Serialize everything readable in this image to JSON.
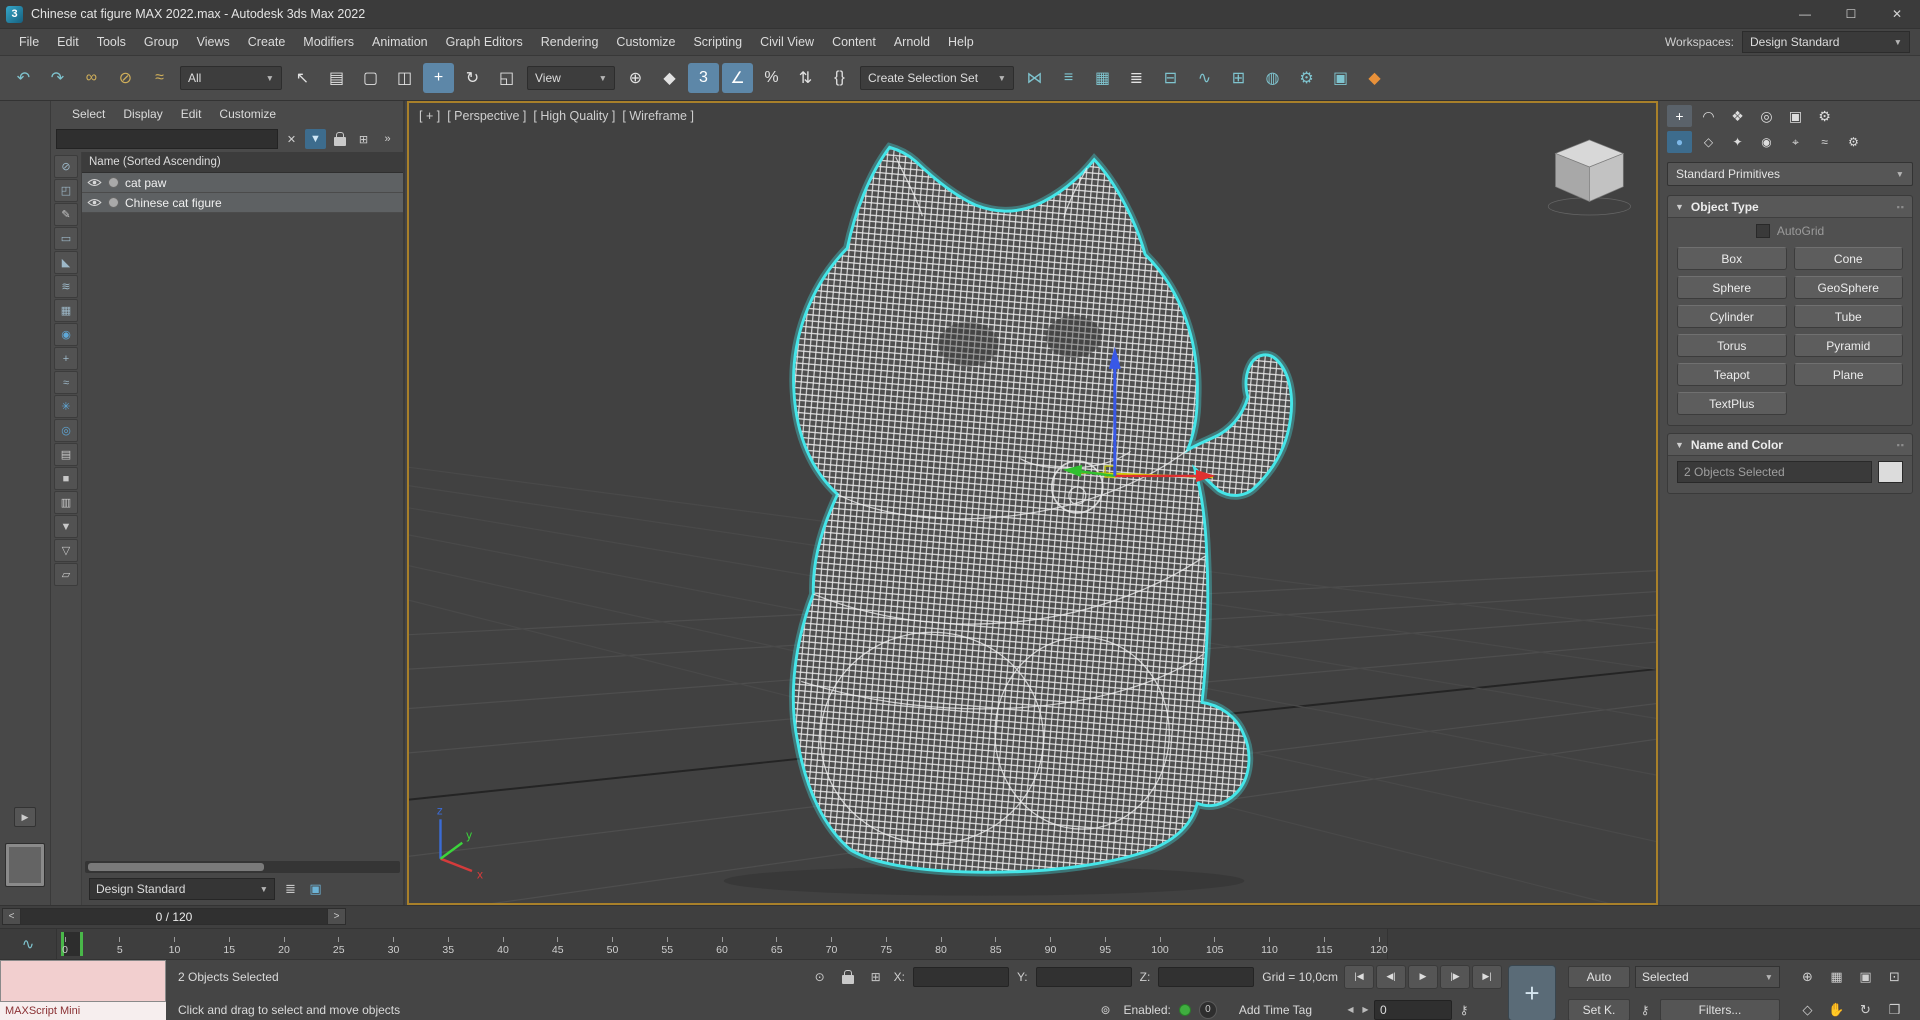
{
  "titlebar": {
    "app_icon_label": "3",
    "title": "Chinese cat figure MAX 2022.max - Autodesk 3ds Max 2022",
    "minimize_glyph": "—",
    "maximize_glyph": "☐",
    "close_glyph": "✕"
  },
  "menubar": {
    "items": [
      "File",
      "Edit",
      "Tools",
      "Group",
      "Views",
      "Create",
      "Modifiers",
      "Animation",
      "Graph Editors",
      "Rendering",
      "Customize",
      "Scripting",
      "Civil View",
      "Content",
      "Arnold",
      "Help"
    ],
    "workspaces_label": "Workspaces:",
    "workspaces_value": "Design Standard"
  },
  "toolbar": {
    "icons_a": [
      {
        "name": "undo-icon",
        "glyph": "↶",
        "color": "#7fc4cf"
      },
      {
        "name": "redo-icon",
        "glyph": "↷",
        "color": "#7fc4cf"
      },
      {
        "name": "select-and-link-icon",
        "glyph": "∞",
        "color": "#cfae5a"
      },
      {
        "name": "unlink-selection-icon",
        "glyph": "⊘",
        "color": "#cfae5a"
      },
      {
        "name": "bind-to-space-warp-icon",
        "glyph": "≈",
        "color": "#cfae5a"
      }
    ],
    "filter_value": "All",
    "icons_b": [
      {
        "name": "select-object-icon",
        "glyph": "↖",
        "color": "#e2e2e2"
      },
      {
        "name": "select-by-name-icon",
        "glyph": "▤",
        "color": "#e2e2e2"
      },
      {
        "name": "rectangular-selection-region-icon",
        "glyph": "▢",
        "color": "#e2e2e2"
      },
      {
        "name": "window-crossing-toggle-icon",
        "glyph": "◫",
        "color": "#e2e2e2"
      },
      {
        "name": "select-and-move-icon",
        "glyph": "+",
        "color": "#ffffff",
        "active": true
      },
      {
        "name": "select-and-rotate-icon",
        "glyph": "↻",
        "color": "#e2e2e2"
      },
      {
        "name": "select-and-scale-icon",
        "glyph": "◱",
        "color": "#e2e2e2"
      }
    ],
    "coord_value": "View",
    "icons_c": [
      {
        "name": "use-pivot-center-icon",
        "glyph": "⊕",
        "color": "#e2e2e2"
      },
      {
        "name": "select-and-manipulate-icon",
        "glyph": "◆",
        "color": "#e2e2e2"
      },
      {
        "name": "snap-toggle-3d-icon",
        "glyph": "3",
        "color": "#ffffff",
        "active": true
      },
      {
        "name": "angle-snap-icon",
        "glyph": "∠",
        "color": "#ffffff",
        "active": true
      },
      {
        "name": "percent-snap-icon",
        "glyph": "%",
        "color": "#e2e2e2"
      },
      {
        "name": "spinner-snap-icon",
        "glyph": "⇅",
        "color": "#e2e2e2"
      },
      {
        "name": "edit-named-selection-sets-icon",
        "glyph": "{}",
        "color": "#e2e2e2"
      }
    ],
    "selection_set_value": "Create Selection Set",
    "icons_d": [
      {
        "name": "mirror-icon",
        "glyph": "⋈",
        "color": "#7fc4cf"
      },
      {
        "name": "align-icon",
        "glyph": "≡",
        "color": "#7fc4cf"
      },
      {
        "name": "toggle-scene-explorer-icon",
        "glyph": "▦",
        "color": "#7fc4cf"
      },
      {
        "name": "toggle-layer-explorer-icon",
        "glyph": "≣",
        "color": "#e2e2e2"
      },
      {
        "name": "toggle-ribbon-icon",
        "glyph": "⊟",
        "color": "#7fc4cf"
      },
      {
        "name": "curve-editor-icon",
        "glyph": "∿",
        "color": "#7fc4cf"
      },
      {
        "name": "schematic-view-icon",
        "glyph": "⊞",
        "color": "#7fc4cf"
      },
      {
        "name": "material-editor-icon",
        "glyph": "◍",
        "color": "#7fc4cf"
      },
      {
        "name": "render-setup-icon",
        "glyph": "⚙",
        "color": "#7fc4cf"
      },
      {
        "name": "rendered-frame-window-icon",
        "glyph": "▣",
        "color": "#7fc4cf"
      },
      {
        "name": "render-production-icon",
        "glyph": "◆",
        "color": "#e8913a"
      }
    ]
  },
  "explorer": {
    "menu": [
      "Select",
      "Display",
      "Edit",
      "Customize"
    ],
    "search_value": "",
    "clear_glyph": "✕",
    "filter_glyph": "▼",
    "pick_glyph": "⊞",
    "overflow_glyph": "»",
    "header": "Name (Sorted Ascending)",
    "rows": [
      {
        "label": "cat paw"
      },
      {
        "label": "Chinese cat figure"
      }
    ],
    "side_icons": [
      {
        "name": "display-none-icon",
        "glyph": "⊘",
        "color": "#9db8c8"
      },
      {
        "name": "display-children-icon",
        "glyph": "◰",
        "color": "#9db8c8"
      },
      {
        "name": "lock-cell-editing-icon",
        "glyph": "✎",
        "color": "#c8c8c8"
      },
      {
        "name": "display-geometry-icon",
        "glyph": "▭",
        "color": "#9db8c8"
      },
      {
        "name": "display-shapes-icon",
        "glyph": "◣",
        "color": "#9db8c8"
      },
      {
        "name": "display-lights-icon",
        "glyph": "≋",
        "color": "#9db8c8"
      },
      {
        "name": "display-cameras-icon",
        "glyph": "▦",
        "color": "#9db8c8"
      },
      {
        "name": "display-materials-icon",
        "glyph": "◉",
        "color": "#5fa8d8"
      },
      {
        "name": "display-helpers-icon",
        "glyph": "+",
        "color": "#9db8c8"
      },
      {
        "name": "display-space-warps-icon",
        "glyph": "≈",
        "color": "#9db8c8"
      },
      {
        "name": "display-particles-icon",
        "glyph": "✳",
        "color": "#5fa8d8"
      },
      {
        "name": "display-visibility-icon",
        "glyph": "◎",
        "color": "#5fa8d8"
      },
      {
        "name": "display-frozen-icon",
        "glyph": "▤",
        "color": "#c8c8c8"
      },
      {
        "name": "display-hidden-icon",
        "glyph": "■",
        "color": "#c8c8c8"
      },
      {
        "name": "display-notes-icon",
        "glyph": "▥",
        "color": "#c8c8c8"
      },
      {
        "name": "filter-combinations-icon",
        "glyph": "▼",
        "color": "#c8c8c8"
      },
      {
        "name": "advanced-filter-icon",
        "glyph": "▽",
        "color": "#c8c8c8"
      },
      {
        "name": "folder-display-icon",
        "glyph": "▱",
        "color": "#c8c8c8"
      }
    ],
    "workspace_dropdown_value": "Design Standard",
    "bottom_icons": [
      {
        "name": "layer-explorer-icon",
        "glyph": "≣",
        "color": "#c8c8c8"
      },
      {
        "name": "scene-explorer-display-icon",
        "glyph": "▣",
        "color": "#6db3d6"
      }
    ]
  },
  "viewport": {
    "labels": [
      {
        "name": "viewport-general-menu",
        "label": "[ + ]"
      },
      {
        "name": "viewport-pov-menu",
        "label": "[ Perspective ]"
      },
      {
        "name": "viewport-quality-menu",
        "label": "[ High Quality ]"
      },
      {
        "name": "viewport-shading-menu",
        "label": "[ Wireframe ]"
      }
    ],
    "axis_x_label": "x",
    "axis_y_label": "y",
    "axis_z_label": "z",
    "selection_outline_color": "#45e6e9"
  },
  "command_panel": {
    "tabs": [
      {
        "name": "create-tab-icon",
        "glyph": "+",
        "active": true
      },
      {
        "name": "modify-tab-icon",
        "glyph": "◠"
      },
      {
        "name": "hierarchy-tab-icon",
        "glyph": "❖"
      },
      {
        "name": "motion-tab-icon",
        "glyph": "◎"
      },
      {
        "name": "display-tab-icon",
        "glyph": "▣"
      },
      {
        "name": "utilities-tab-icon",
        "glyph": "⚙"
      }
    ],
    "subtabs": [
      {
        "name": "geometry-category-icon",
        "glyph": "●",
        "color": "#7db8e8",
        "active": true
      },
      {
        "name": "shapes-category-icon",
        "glyph": "◇"
      },
      {
        "name": "lights-category-icon",
        "glyph": "✦"
      },
      {
        "name": "cameras-category-icon",
        "glyph": "◉"
      },
      {
        "name": "helpers-category-icon",
        "glyph": "⌖"
      },
      {
        "name": "space-warps-category-icon",
        "glyph": "≈"
      },
      {
        "name": "systems-category-icon",
        "glyph": "⚙"
      }
    ],
    "category_dropdown_value": "Standard Primitives",
    "object_type_title": "Object Type",
    "autogrid_label": "AutoGrid",
    "primitive_buttons": [
      {
        "name": "box-button",
        "label": "Box"
      },
      {
        "name": "cone-button",
        "label": "Cone"
      },
      {
        "name": "sphere-button",
        "label": "Sphere"
      },
      {
        "name": "geosphere-button",
        "label": "GeoSphere"
      },
      {
        "name": "cylinder-button",
        "label": "Cylinder"
      },
      {
        "name": "tube-button",
        "label": "Tube"
      },
      {
        "name": "torus-button",
        "label": "Torus"
      },
      {
        "name": "pyramid-button",
        "label": "Pyramid"
      },
      {
        "name": "teapot-button",
        "label": "Teapot"
      },
      {
        "name": "plane-button",
        "label": "Plane"
      },
      {
        "name": "textplus-button",
        "label": "TextPlus"
      }
    ],
    "name_color_title": "Name and Color",
    "name_field_value": "2 Objects Selected"
  },
  "timeline": {
    "slider_value": "0 / 120",
    "prev_glyph": "<",
    "next_glyph": ">",
    "mini_curve_glyph": "∿",
    "ticks": [
      "0",
      "5",
      "10",
      "15",
      "20",
      "25",
      "30",
      "35",
      "40",
      "45",
      "50",
      "55",
      "60",
      "65",
      "70",
      "75",
      "80",
      "85",
      "90",
      "95",
      "100",
      "105",
      "110",
      "115",
      "120"
    ]
  },
  "statusbar": {
    "maxscript_label": "MAXScript Mini",
    "selection_status": "2 Objects Selected",
    "prompt": "Click and drag to select and move objects",
    "isolate_glyph": "⊙",
    "absolute_glyph": "⊞",
    "x_label": "X:",
    "y_label": "Y:",
    "z_label": "Z:",
    "x_value": "",
    "y_value": "",
    "z_value": "",
    "grid_label": "Grid = 10,0cm",
    "playback_glyph": "⊚",
    "enabled_label": "Enabled:",
    "enabled_value": "0",
    "add_time_tag_label": "Add Time Tag",
    "transport": [
      {
        "name": "go-to-start-button",
        "glyph": "|◀"
      },
      {
        "name": "previous-frame-button",
        "glyph": "◀|"
      },
      {
        "name": "play-button",
        "glyph": "▶"
      },
      {
        "name": "next-frame-button",
        "glyph": "|▶"
      },
      {
        "name": "go-to-end-button",
        "glyph": "▶|"
      }
    ],
    "key_step_prev_glyph": "◀",
    "key_step_next_glyph": "▶",
    "frame_value": "0",
    "set_keys_glyph": "+",
    "auto_key_label": "Auto",
    "key_set_dropdown_value": "Selected",
    "set_key_label": "Set K.",
    "key_filters_glyph": "⚷",
    "filters_label": "Filters...",
    "nav_icons_top": [
      {
        "name": "zoom-icon",
        "glyph": "⊕"
      },
      {
        "name": "zoom-all-icon",
        "glyph": "▦"
      },
      {
        "name": "zoom-extents-icon",
        "glyph": "▣"
      },
      {
        "name": "zoom-region-icon",
        "glyph": "⊡"
      }
    ],
    "nav_icons_bottom": [
      {
        "name": "field-of-view-icon",
        "glyph": "◇"
      },
      {
        "name": "pan-icon",
        "glyph": "✋"
      },
      {
        "name": "orbit-icon",
        "glyph": "↻"
      },
      {
        "name": "maximize-viewport-icon",
        "glyph": "❒"
      }
    ]
  }
}
